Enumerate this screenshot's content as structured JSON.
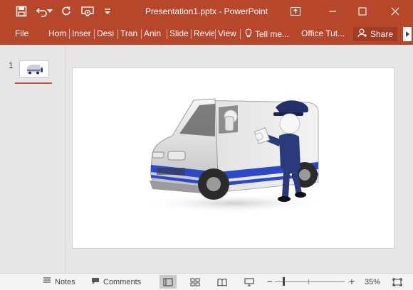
{
  "titlebar": {
    "title": "Presentation1.pptx - PowerPoint",
    "icons": [
      "save-icon",
      "undo-icon",
      "undo-dropdown-icon",
      "redo-icon",
      "present-from-beginning-icon",
      "customize-qat-icon",
      "ribbon-display-options-icon",
      "minimize-icon",
      "maximize-icon",
      "close-icon"
    ]
  },
  "ribbon": {
    "tabs": [
      "File",
      "Hom",
      "Inser",
      "Desi",
      "Tran",
      "Anin",
      "Slide",
      "Revie",
      "View"
    ],
    "tell_me": "Tell me...",
    "office_tutorials": "Office Tut...",
    "share": "Share"
  },
  "thumbnails": {
    "slide_number": "1"
  },
  "statusbar": {
    "notes": "Notes",
    "comments": "Comments",
    "zoom": "35%"
  },
  "colors": {
    "accent": "#b7472a",
    "accent_dark": "#a33b22",
    "van_blue": "#2c49c9"
  }
}
